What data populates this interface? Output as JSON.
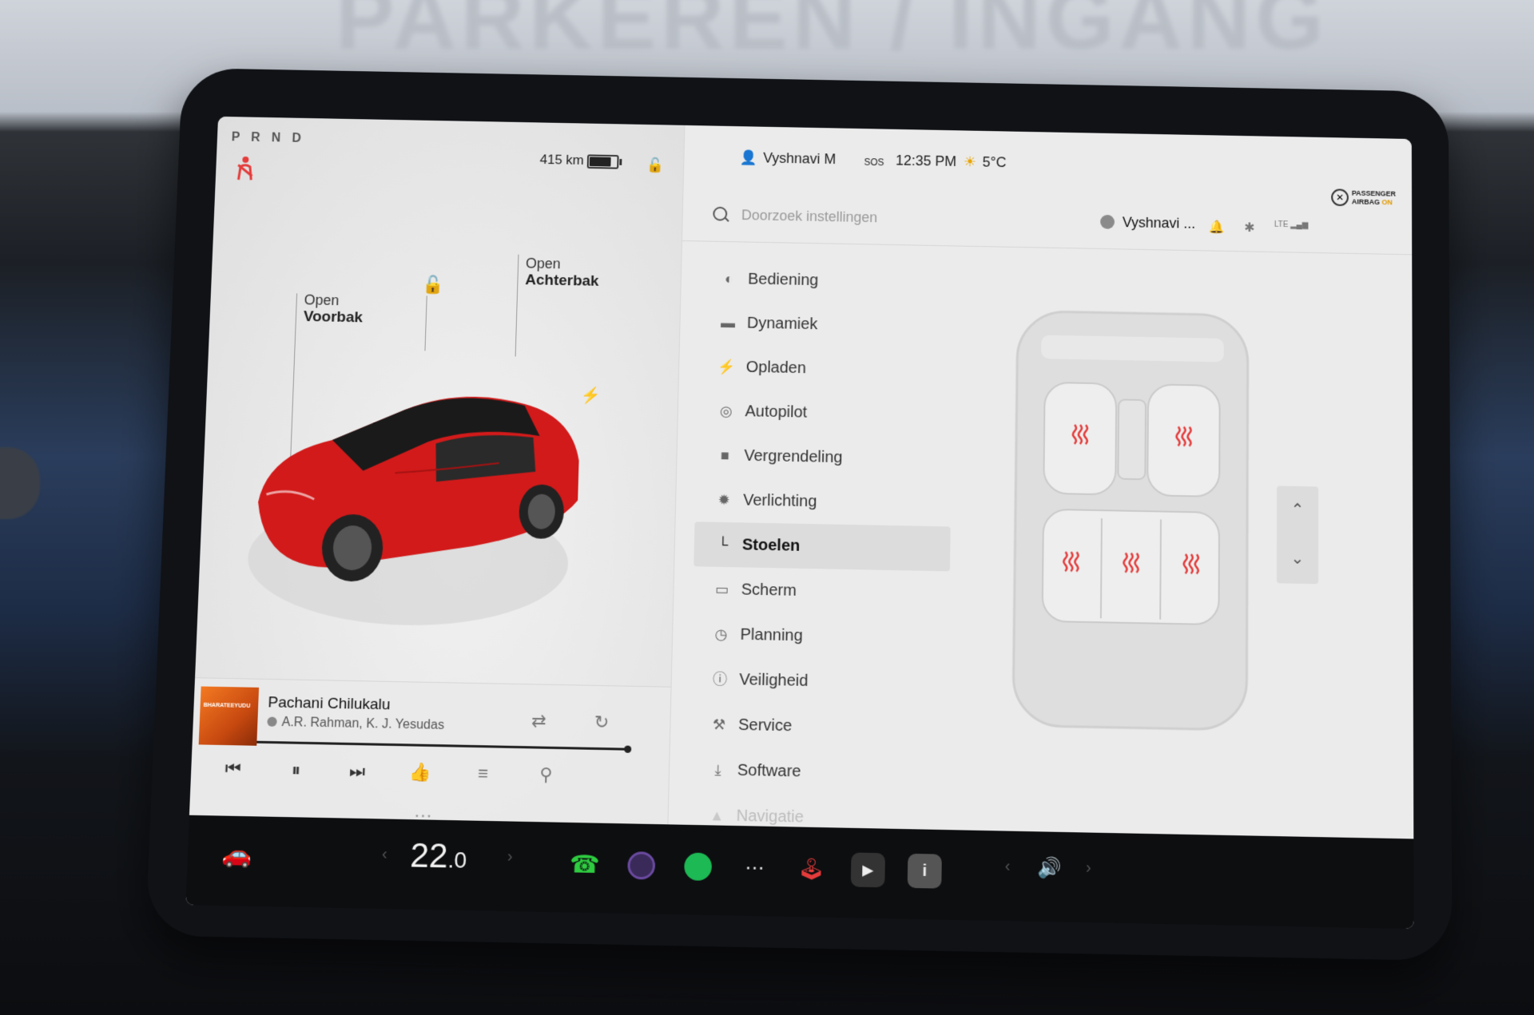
{
  "background": {
    "sign_text": "PARKEREN / INGANG"
  },
  "status_left": {
    "gear": "P R N D",
    "range": "415 km",
    "battery_level": 0.85
  },
  "car": {
    "front_trunk_action": "Open",
    "front_trunk_label": "Voorbak",
    "rear_trunk_action": "Open",
    "rear_trunk_label": "Achterbak",
    "body_color": "#d21a1a"
  },
  "media": {
    "album_caption": "BHARATEEYUDU",
    "song": "Pachani Chilukalu",
    "artist": "A.R. Rahman, K. J. Yesudas",
    "progress": 1.0
  },
  "status_right": {
    "user": "Vyshnavi M",
    "sos": "SOS",
    "time": "12:35 PM",
    "temperature": "5°C",
    "airbag_line1": "PASSENGER",
    "airbag_line2": "AIRBAG",
    "airbag_state": "ON"
  },
  "search": {
    "placeholder": "Doorzoek instellingen"
  },
  "header": {
    "profile_name": "Vyshnavi ...",
    "lte": "LTE"
  },
  "menu": [
    {
      "label": "Bediening",
      "icon": "toggle-icon"
    },
    {
      "label": "Dynamiek",
      "icon": "car-icon"
    },
    {
      "label": "Opladen",
      "icon": "bolt-icon"
    },
    {
      "label": "Autopilot",
      "icon": "steering-wheel-icon"
    },
    {
      "label": "Vergrendeling",
      "icon": "lock-icon"
    },
    {
      "label": "Verlichting",
      "icon": "light-icon"
    },
    {
      "label": "Stoelen",
      "icon": "seat-icon",
      "active": true
    },
    {
      "label": "Scherm",
      "icon": "screen-icon"
    },
    {
      "label": "Planning",
      "icon": "clock-icon"
    },
    {
      "label": "Veiligheid",
      "icon": "safety-icon"
    },
    {
      "label": "Service",
      "icon": "wrench-icon"
    },
    {
      "label": "Software",
      "icon": "download-icon"
    },
    {
      "label": "Navigatie",
      "icon": "navigation-icon",
      "faded": true
    }
  ],
  "seats": {
    "heat_color": "#e53b3b"
  },
  "dock": {
    "temperature_whole": "22",
    "temperature_decimal": ".0",
    "phone_color": "#2ecc40",
    "spotify_color": "#1db954"
  }
}
